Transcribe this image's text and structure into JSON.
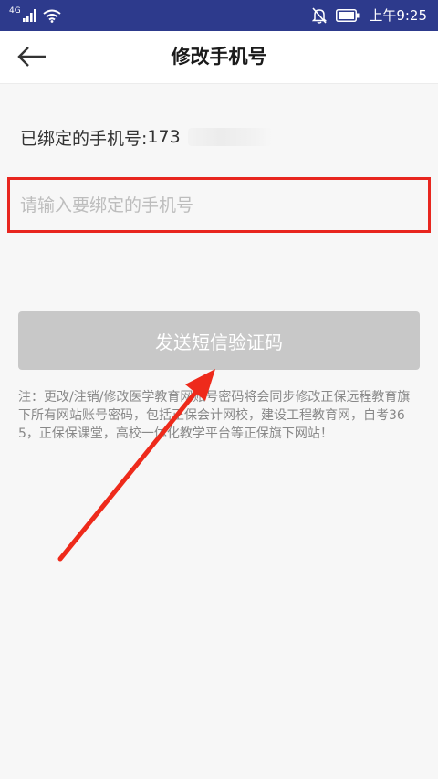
{
  "status_bar": {
    "network": "4G",
    "time": "上午9:25",
    "icons": [
      "signal-icon",
      "wifi-icon",
      "bell-off-icon",
      "battery-icon"
    ]
  },
  "header": {
    "title": "修改手机号",
    "back_icon": "arrow-left-icon"
  },
  "bound_phone": {
    "label": "已绑定的手机号:",
    "number_prefix": "173"
  },
  "phone_input": {
    "placeholder": "请输入要绑定的手机号",
    "value": ""
  },
  "send_button": {
    "label": "发送短信验证码"
  },
  "note": "注：更改/注销/修改医学教育网账号密码将会同步修改正保远程教育旗下所有网站账号密码，包括正保会计网校，建设工程教育网，自考365，正保保课堂，高校一体化教学平台等正保旗下网站！",
  "colors": {
    "status_bar": "#2d3a8c",
    "highlight_border": "#e8261f",
    "annotation_arrow": "#ee2a1b",
    "button_disabled": "#c8c8c8",
    "background": "#f7f7f7"
  }
}
